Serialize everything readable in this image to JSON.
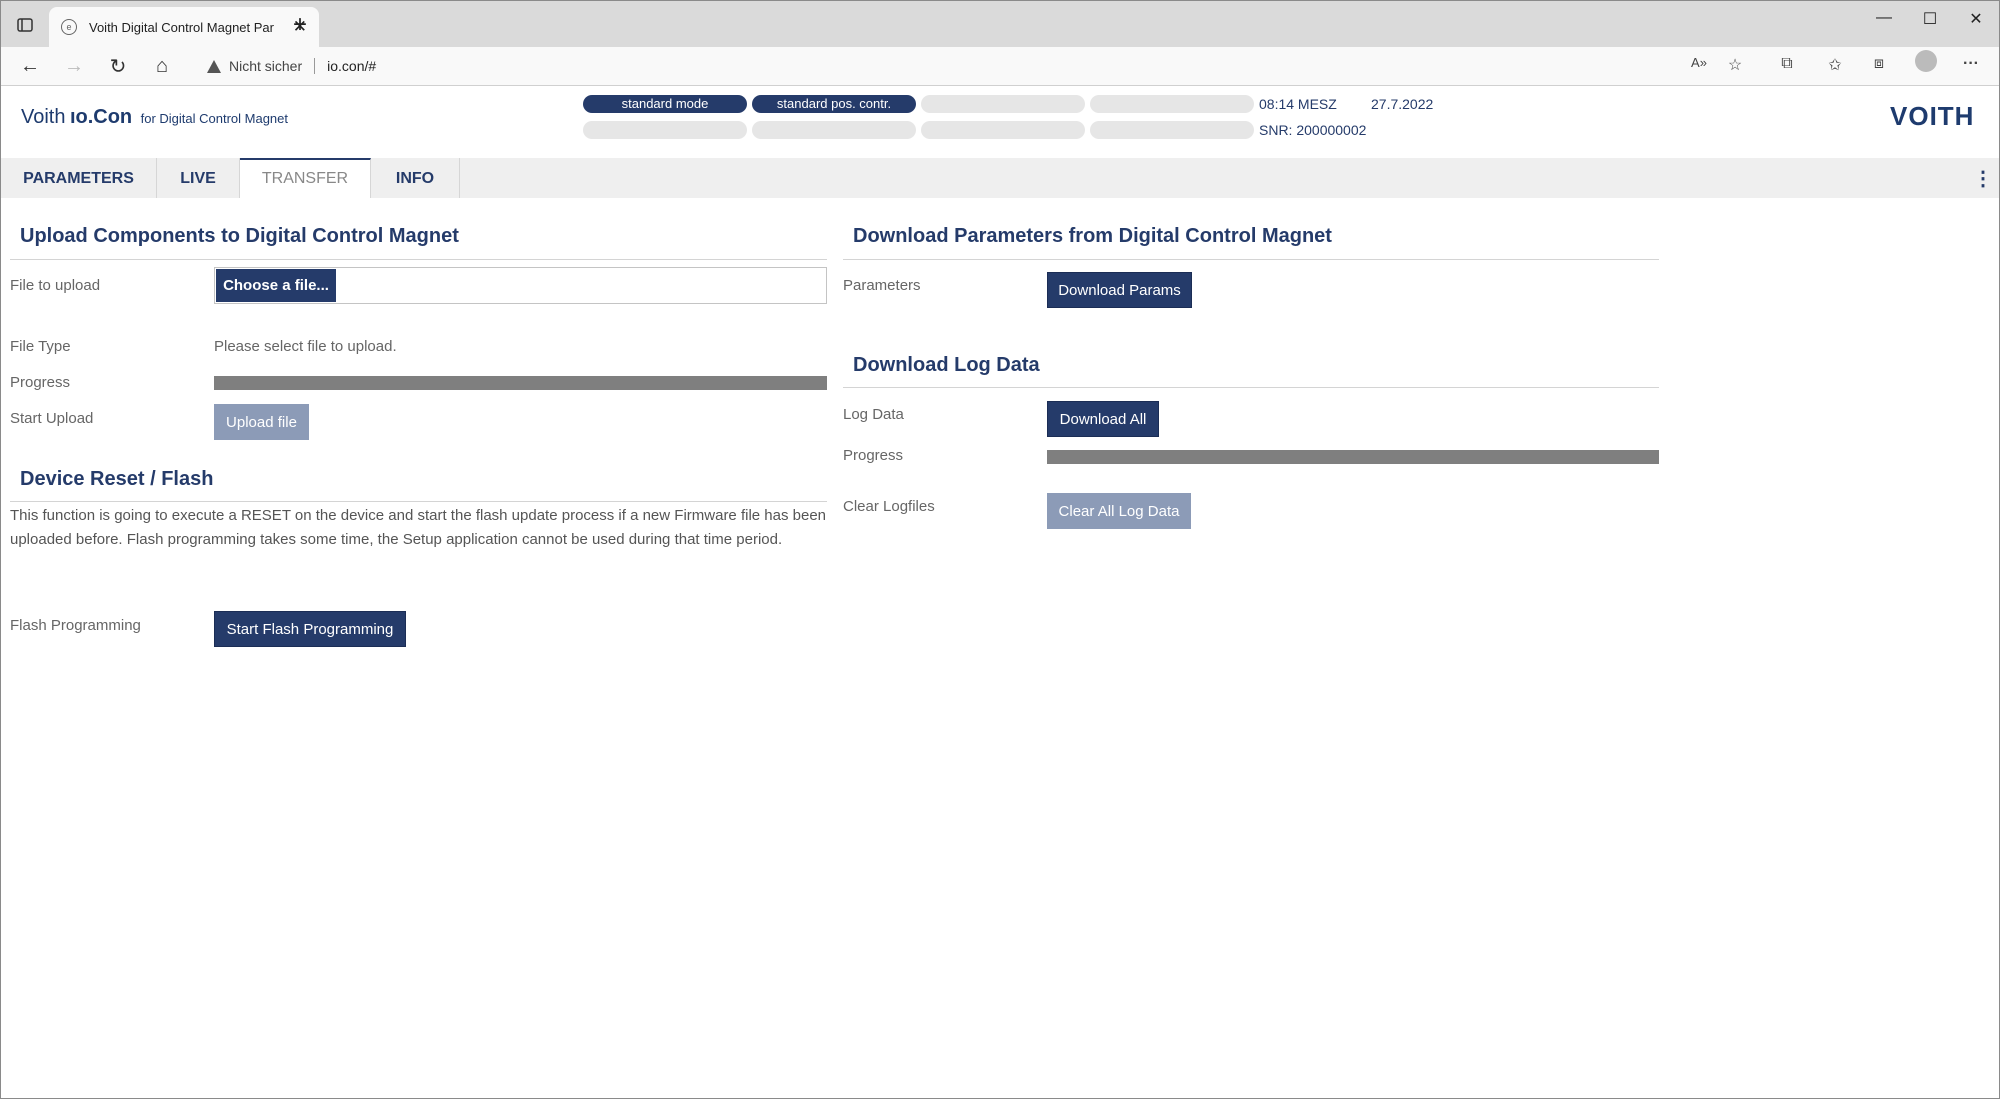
{
  "browser": {
    "tab_title": "Voith Digital Control Magnet Par",
    "security_label": "Nicht sicher",
    "url": "io.con/#"
  },
  "header": {
    "brand_voith": "Voith",
    "brand_iocon": "ıo.Con",
    "brand_for": "for Digital Control Magnet",
    "mode_pill_1": "standard mode",
    "mode_pill_2": "standard pos. contr.",
    "time": "08:14 MESZ",
    "date": "27.7.2022",
    "serial": "SNR: 200000002",
    "logo": "VOITH"
  },
  "tabs": [
    {
      "label": "PARAMETERS"
    },
    {
      "label": "LIVE"
    },
    {
      "label": "TRANSFER",
      "active": true
    },
    {
      "label": "INFO"
    }
  ],
  "upload": {
    "title": "Upload Components to Digital Control Magnet",
    "file_label": "File to upload",
    "choose_button": "Choose a file...",
    "filetype_label": "File Type",
    "filetype_value": "Please select file to upload.",
    "progress_label": "Progress",
    "progress": 0,
    "start_label": "Start Upload",
    "upload_button": "Upload file"
  },
  "reset": {
    "title": "Device Reset / Flash",
    "description": "This function is going to execute a RESET on the device and start the flash update process if a new Firmware file has been uploaded before. Flash programming takes some time, the Setup application cannot be used during that time period.",
    "flash_label": "Flash Programming",
    "flash_button": "Start Flash Programming"
  },
  "download_params": {
    "title": "Download Parameters from Digital Control Magnet",
    "params_label": "Parameters",
    "params_button": "Download Params"
  },
  "download_log": {
    "title": "Download Log Data",
    "log_label": "Log Data",
    "log_button": "Download All",
    "progress_label": "Progress",
    "progress": 0,
    "clear_label": "Clear Logfiles",
    "clear_button": "Clear All Log Data"
  },
  "colors": {
    "primary": "#253b6a",
    "disabled": "#8c9bb7",
    "progress_track": "#7f7f7f"
  }
}
